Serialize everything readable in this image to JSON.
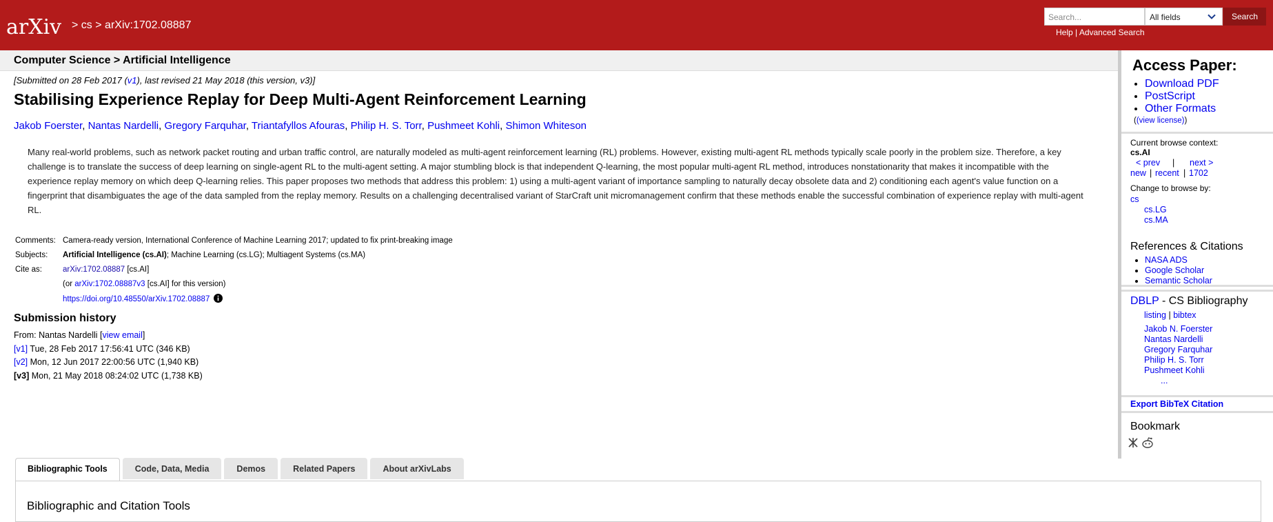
{
  "header": {
    "logo_text": "arXiv",
    "breadcrumb": [
      "cs",
      "arXiv:1702.08887"
    ],
    "breadcrumb_sep": ">",
    "search_placeholder": "Search...",
    "search_field": "All fields",
    "search_button": "Search",
    "help": "Help",
    "help_sep": "|",
    "advanced": "Advanced Search"
  },
  "subheader": {
    "text": "Computer Science > Artificial Intelligence"
  },
  "paper": {
    "submitted_pre": "[Submitted on 28 Feb 2017 (",
    "submitted_v1": "v1",
    "submitted_post": "), last revised 21 May 2018 (this version, v3)]",
    "title": "Stabilising Experience Replay for Deep Multi-Agent Reinforcement Learning",
    "authors": [
      "Jakob Foerster",
      "Nantas Nardelli",
      "Gregory Farquhar",
      "Triantafyllos Afouras",
      "Philip H. S. Torr",
      "Pushmeet Kohli",
      "Shimon Whiteson"
    ],
    "abstract": "Many real-world problems, such as network packet routing and urban traffic control, are naturally modeled as multi-agent reinforcement learning (RL) problems. However, existing multi-agent RL methods typically scale poorly in the problem size. Therefore, a key challenge is to translate the success of deep learning on single-agent RL to the multi-agent setting. A major stumbling block is that independent Q-learning, the most popular multi-agent RL method, introduces nonstationarity that makes it incompatible with the experience replay memory on which deep Q-learning relies. This paper proposes two methods that address this problem: 1) using a multi-agent variant of importance sampling to naturally decay obsolete data and 2) conditioning each agent's value function on a fingerprint that disambiguates the age of the data sampled from the replay memory. Results on a challenging decentralised variant of StarCraft unit micromanagement confirm that these methods enable the successful combination of experience replay with multi-agent RL."
  },
  "meta": {
    "comments_label": "Comments:",
    "comments": "Camera-ready version, International Conference of Machine Learning 2017; updated to fix print-breaking image",
    "subjects_label": "Subjects:",
    "subjects_bold": "Artificial Intelligence (cs.AI)",
    "subjects_rest": "; Machine Learning (cs.LG); Multiagent Systems (cs.MA)",
    "cite_label": "Cite as:",
    "cite_id": "arXiv:1702.08887",
    "cite_tag": " [cs.AI]",
    "cite2_pre": "(or ",
    "cite2_id": "arXiv:1702.08887v3",
    "cite2_post": " [cs.AI] for this version)",
    "doi": "https://doi.org/10.48550/arXiv.1702.08887"
  },
  "history": {
    "title": "Submission history",
    "from_pre": "From: Nantas Nardelli [",
    "view_email": "view email",
    "from_post": "]",
    "versions": [
      {
        "tag": "[v1]",
        "text": " Tue, 28 Feb 2017 17:56:41 UTC (346 KB)"
      },
      {
        "tag": "[v2]",
        "text": " Mon, 12 Jun 2017 22:00:56 UTC (1,940 KB)"
      },
      {
        "tag": "[v3]",
        "text": " Mon, 21 May 2018 08:24:02 UTC (1,738 KB)"
      }
    ]
  },
  "tabs": [
    "Bibliographic Tools",
    "Code, Data, Media",
    "Demos",
    "Related Papers",
    "About arXivLabs"
  ],
  "tab_panel_heading": "Bibliographic and Citation Tools",
  "sidebar": {
    "access_title": "Access Paper:",
    "access_links": [
      "Download PDF",
      "PostScript",
      "Other Formats"
    ],
    "license": "(view license)",
    "context_label": "Current browse context:",
    "context": "cs.AI",
    "prev": "< prev",
    "next": "next >",
    "nav_sep": "|",
    "new": "new",
    "recent": "recent",
    "month": "1702",
    "change_label": "Change to browse by:",
    "change_links": [
      "cs",
      "cs.LG",
      "cs.MA"
    ],
    "refs_title": "References & Citations",
    "refs_links": [
      "NASA ADS",
      "Google Scholar",
      "Semantic Scholar"
    ],
    "dblp": "DBLP",
    "dblp_rest": " - CS Bibliography",
    "listing": "listing",
    "bibtex": "bibtex",
    "dblp_authors": [
      "Jakob N. Foerster",
      "Nantas Nardelli",
      "Gregory Farquhar",
      "Philip H. S. Torr",
      "Pushmeet Kohli"
    ],
    "ellipsis": "...",
    "export": "Export BibTeX Citation",
    "bookmark": "Bookmark"
  }
}
